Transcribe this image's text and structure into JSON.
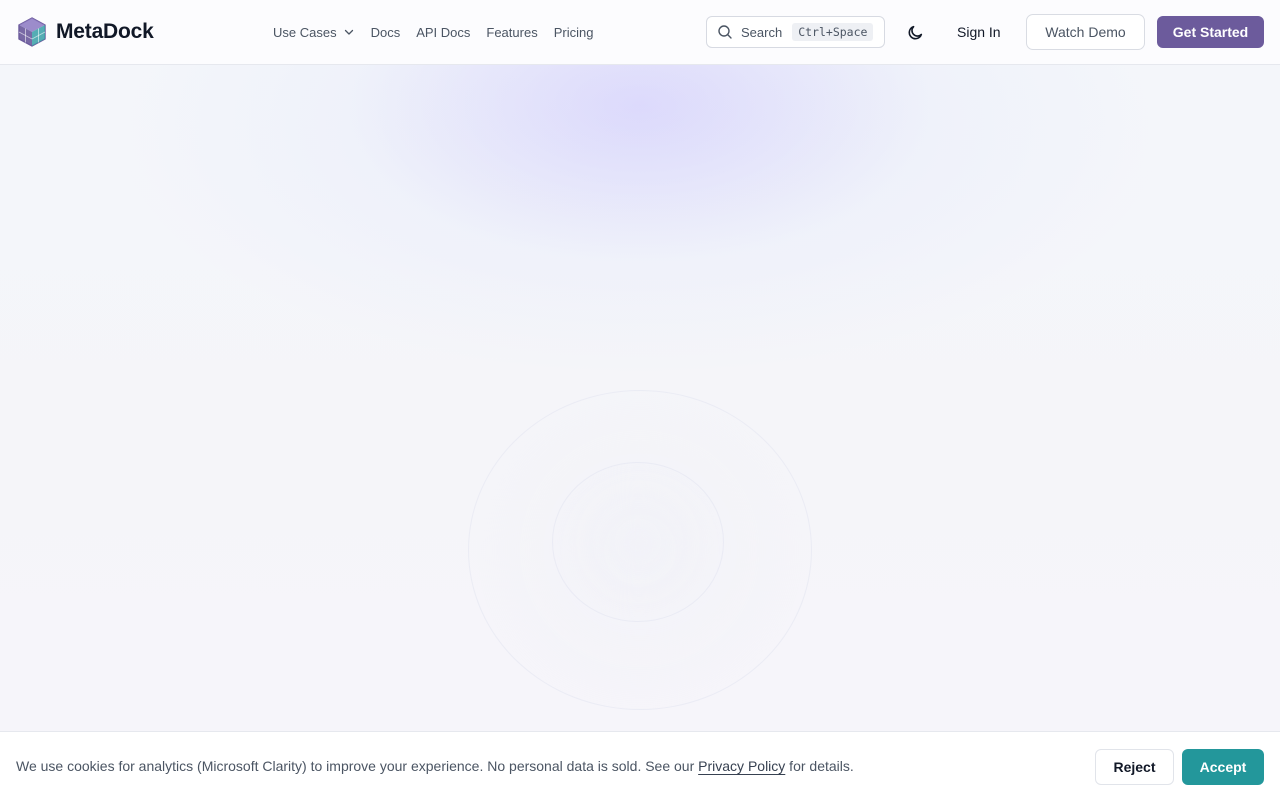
{
  "brand": {
    "name": "MetaDock",
    "logo_icon": "cube-logo-icon"
  },
  "nav": {
    "items": [
      {
        "label": "Use Cases",
        "has_dropdown": true
      },
      {
        "label": "Docs"
      },
      {
        "label": "API Docs"
      },
      {
        "label": "Features"
      },
      {
        "label": "Pricing"
      }
    ]
  },
  "search": {
    "label": "Search",
    "shortcut": "Ctrl+Space",
    "icon": "search-icon"
  },
  "theme_toggle": {
    "icon": "moon-icon"
  },
  "actions": {
    "sign_in": "Sign In",
    "watch_demo": "Watch Demo",
    "get_started": "Get Started"
  },
  "cookie": {
    "text_before": "We use cookies for analytics (Microsoft Clarity) to improve your experience. No personal data is sold. See our ",
    "link": "Privacy Policy",
    "text_after": " for details.",
    "reject": "Reject",
    "accept": "Accept"
  },
  "colors": {
    "primary": "#6c5b9c",
    "accent": "#23979b"
  }
}
